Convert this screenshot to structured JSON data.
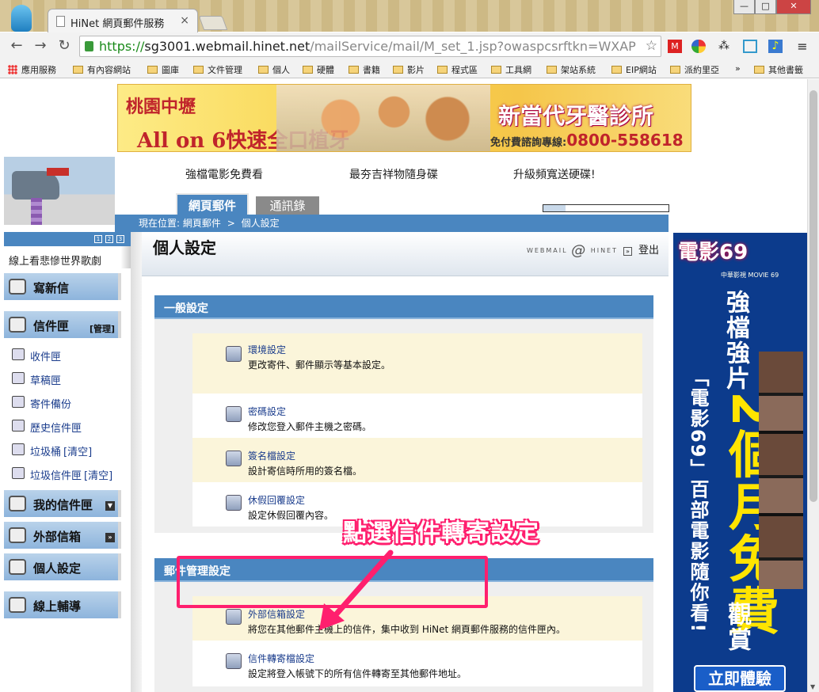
{
  "browser": {
    "tab_title": "HiNet 網頁郵件服務",
    "tab_close": "×",
    "url_scheme": "https://",
    "url_host": "sg3001.webmail.hinet.net",
    "url_path": "/mailService/mail/M_set_1.jsp?owaspcsrftkn=WXAP",
    "win_min": "—",
    "win_max": "□",
    "win_close": "✕",
    "back": "←",
    "forward": "→",
    "reload": "↻",
    "star": "☆",
    "menu": "≡",
    "bookmarks": [
      "應用服務",
      "有內容網站",
      "圖庫",
      "文件管理",
      "個人",
      "硬體",
      "書籍",
      "影片",
      "程式區",
      "工具網",
      "架站系統",
      "EIP網站",
      "派約里亞"
    ],
    "bookmarks_more": "»",
    "bookmarks_other": "其他書籤"
  },
  "banner": {
    "left_line1": "桃園中壢",
    "left_line2": "All on 6快速全口植牙",
    "right_line1": "新當代牙醫診所",
    "right_line2_prefix": "免付費諮詢專線:",
    "right_line2_phone": "0800-558618"
  },
  "promos": [
    "強檔電影免費看",
    "最夯吉祥物隨身碟",
    "升級頻寬送硬碟!"
  ],
  "nav_tabs": {
    "mail": "網頁郵件",
    "contacts": "通訊錄"
  },
  "quota": {
    "used_fraction": 0.18
  },
  "breadcrumb": {
    "prefix": "現在位置:",
    "level1": "網頁郵件",
    "separator": ">",
    "level2": "個人設定"
  },
  "sidebar": {
    "marquee": "線上看悲慘世界歌劇",
    "compose": "寫新信",
    "mailbox": "信件匣",
    "manage": "[管理]",
    "items": [
      {
        "label": "收件匣",
        "suffix": ""
      },
      {
        "label": "草稿匣",
        "suffix": ""
      },
      {
        "label": "寄件備份",
        "suffix": ""
      },
      {
        "label": "歷史信件匣",
        "suffix": ""
      },
      {
        "label": "垃圾桶",
        "suffix": "[清空]"
      },
      {
        "label": "垃圾信件匣",
        "suffix": "[清空]"
      }
    ],
    "my_folders": "我的信件匣",
    "external": "外部信箱",
    "personal": "個人設定",
    "help": "線上輔導"
  },
  "page_title": "個人設定",
  "brand": {
    "left": "WEBMAIL",
    "at": "@",
    "right": "HINET"
  },
  "logout": "登出",
  "logout_arrow": "»",
  "sections": [
    {
      "title": "一般設定",
      "items": [
        {
          "title": "環境設定",
          "desc": "更改寄件、郵件顯示等基本設定。"
        },
        {
          "title": "密碼設定",
          "desc": "修改您登入郵件主機之密碼。"
        },
        {
          "title": "簽名檔設定",
          "desc": "設計寄信時所用的簽名檔。"
        },
        {
          "title": "休假回覆設定",
          "desc": "設定休假回覆內容。"
        }
      ]
    },
    {
      "title": "郵件管理設定",
      "items": [
        {
          "title": "外部信箱設定",
          "desc": "將您在其他郵件主機上的信件，集中收到 HiNet 網頁郵件服務的信件匣內。"
        },
        {
          "title": "信件轉寄檔設定",
          "desc": "設定將登入帳號下的所有信件轉寄至其他郵件地址。"
        }
      ]
    }
  ],
  "annotation": "點選信件轉寄設定",
  "right_ad": {
    "brand": "電影69",
    "brand_sub": "中華影視 MOVIE 69",
    "line1": "強檔強片",
    "big": "2個月免費",
    "line2": "觀賞",
    "quote": "「電影69」百部電影隨你看!",
    "cta": "立即體驗"
  },
  "colors": {
    "accent_blue": "#4a86c0",
    "highlight_pink": "#ff1f6e",
    "row_cream": "#fbf5da"
  }
}
